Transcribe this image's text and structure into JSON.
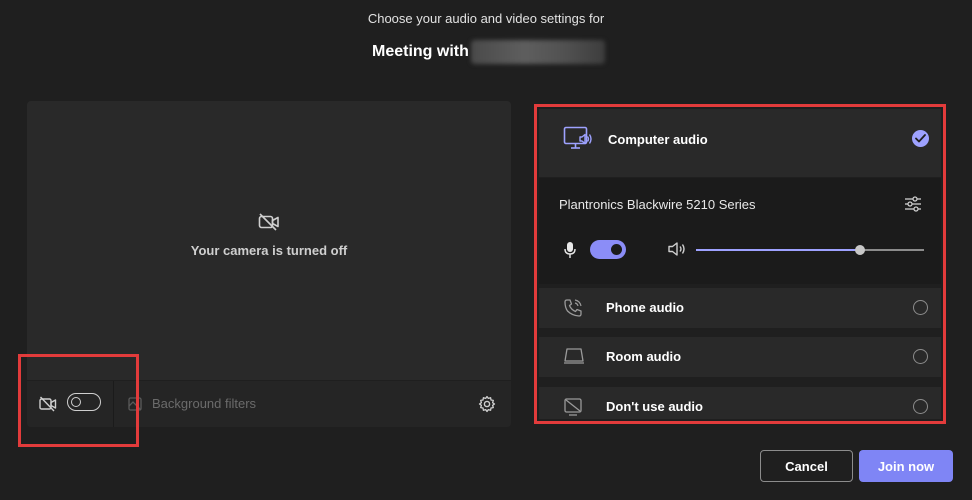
{
  "header": {
    "subtitle": "Choose your audio and video settings for",
    "title": "Meeting with"
  },
  "video": {
    "status_text": "Your camera is turned off",
    "camera_toggle_on": false,
    "background_filters_label": "Background filters"
  },
  "audio": {
    "computer_audio": {
      "label": "Computer audio",
      "selected": true
    },
    "device": {
      "name": "Plantronics Blackwire 5210 Series",
      "mic_on": true,
      "speaker_volume_percent": 72
    },
    "options": [
      {
        "label": "Phone audio",
        "icon": "phone-icon",
        "selected": false
      },
      {
        "label": "Room audio",
        "icon": "room-display-icon",
        "selected": false
      },
      {
        "label": "Don't use audio",
        "icon": "no-audio-icon",
        "selected": false
      }
    ]
  },
  "actions": {
    "cancel_label": "Cancel",
    "join_label": "Join now"
  },
  "colors": {
    "accent": "#7f85f5",
    "accent_light": "#9ea2ff",
    "highlight": "#e23b3b",
    "background": "#1f1f1f",
    "panel": "#292929"
  }
}
